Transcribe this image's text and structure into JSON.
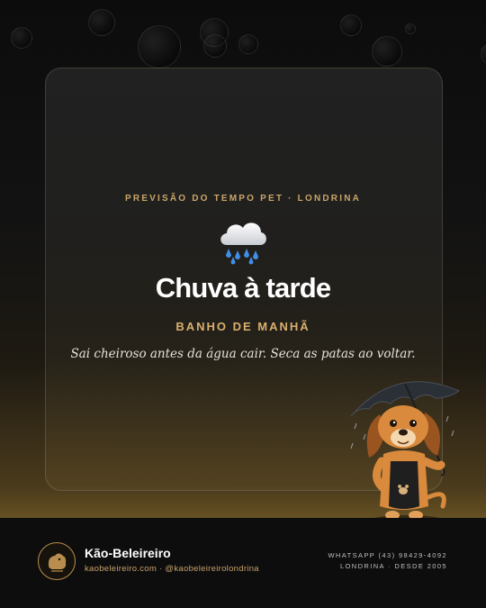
{
  "card": {
    "kicker": "PREVISÃO DO TEMPO PET · LONDRINA",
    "weather_icon": "rain-cloud-icon",
    "title": "Chuva à tarde",
    "subtitle": "BANHO DE MANHÃ",
    "description": "Sai cheiroso antes da água cair. Seca as patas ao voltar."
  },
  "illustration": {
    "icon": "dog-with-umbrella-icon"
  },
  "footer": {
    "logo_icon": "dog-logo-icon",
    "brand": "Kão-Beleireiro",
    "links": "kaobeleireiro.com · @kaobeleireirolondrina",
    "contact_line1": "WHATSAPP (43) 98429-4092",
    "contact_line2": "LONDRINA · DESDE 2005"
  },
  "colors": {
    "accent": "#caa56a",
    "background": "#0b0b0b",
    "title": "#ffffff"
  }
}
